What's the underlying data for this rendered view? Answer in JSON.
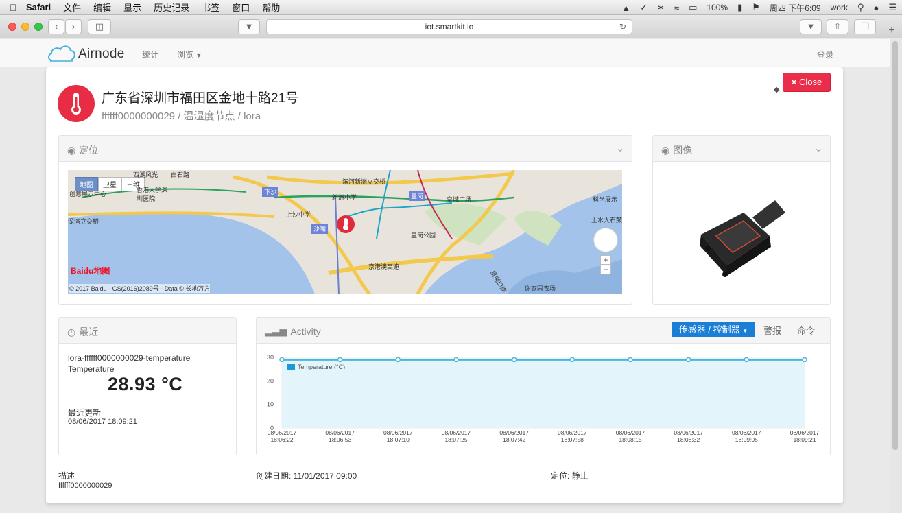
{
  "menubar": {
    "items": [
      "Safari",
      "文件",
      "编辑",
      "显示",
      "历史记录",
      "书签",
      "窗口",
      "帮助"
    ],
    "battery": "100%",
    "clock": "周四 下午6:09",
    "user": "work"
  },
  "browser": {
    "url": "iot.smartkit.io"
  },
  "nav": {
    "brand": "Airnode",
    "stats": "统计",
    "browse": "浏览",
    "login": "登录"
  },
  "node": {
    "address": "广东省深圳市福田区金地十路21号",
    "subtitle": "ffffff0000000029 / 温湿度节点 / lora",
    "close_label": "Close"
  },
  "location_panel": {
    "title": "定位",
    "map_types": [
      "地图",
      "卫星",
      "三维"
    ],
    "places": [
      "西湖风光",
      "白石路",
      "香港大学深圳医院",
      "创意展示中心",
      "深湾立交桥",
      "下沙",
      "上沙中学",
      "沙嘴",
      "滨河新洲立交桥",
      "新洲小学",
      "皇岗",
      "皇城广场",
      "皇岗公园",
      "京港澳高速",
      "科学展示",
      "上水大石鼓",
      "谢家园农场",
      "皇岗口岸"
    ],
    "copyright": "© 2017 Baidu - GS(2016)2089号 - Data © 长地万方",
    "baidu_logo": "Baidu地图"
  },
  "image_panel": {
    "title": "图像"
  },
  "recent_panel": {
    "title": "最近",
    "sensor_id": "lora-ffffff0000000029-temperature",
    "sensor_label": "Temperature",
    "value": "28.93 °C",
    "updated_label": "最近更新",
    "updated": "08/06/2017 18:09:21"
  },
  "activity_panel": {
    "title": "Activity",
    "dropdown": "传感器 / 控制器",
    "tab_alarm": "警报",
    "tab_cmd": "命令"
  },
  "chart_data": {
    "type": "area",
    "x": [
      "08/06/2017 18:06:22",
      "08/06/2017 18:06:53",
      "08/06/2017 18:07:10",
      "08/06/2017 18:07:25",
      "08/06/2017 18:07:42",
      "08/06/2017 18:07:58",
      "08/06/2017 18:08:15",
      "08/06/2017 18:08:32",
      "08/06/2017 18:09:05",
      "08/06/2017 18:09:21"
    ],
    "x_tick_labels": [
      [
        "08/06/2017",
        "18:06:22"
      ],
      [
        "08/06/2017",
        "18:06:53"
      ],
      [
        "08/06/2017",
        "18:07:10"
      ],
      [
        "08/06/2017",
        "18:07:25"
      ],
      [
        "08/06/2017",
        "18:07:42"
      ],
      [
        "08/06/2017",
        "18:07:58"
      ],
      [
        "08/06/2017",
        "18:08:15"
      ],
      [
        "08/06/2017",
        "18:08:32"
      ],
      [
        "08/06/2017",
        "18:09:05"
      ],
      [
        "08/06/2017",
        "18:09:21"
      ]
    ],
    "series": [
      {
        "name": "Temperature (°C)",
        "values": [
          29,
          29,
          29,
          29,
          29,
          29,
          29,
          29,
          29,
          29
        ]
      }
    ],
    "yticks": [
      "0",
      "10",
      "20",
      "30"
    ],
    "ylim": [
      0,
      30
    ],
    "grid": true,
    "legend": "top-left",
    "line_color": "#49b6d6",
    "fill_color": "#e3f5fb"
  },
  "footer": {
    "desc_label": "描述",
    "desc_value": "ffffff0000000029",
    "created": "创建日期: 11/01/2017 09:00",
    "position": "定位: 静止"
  }
}
